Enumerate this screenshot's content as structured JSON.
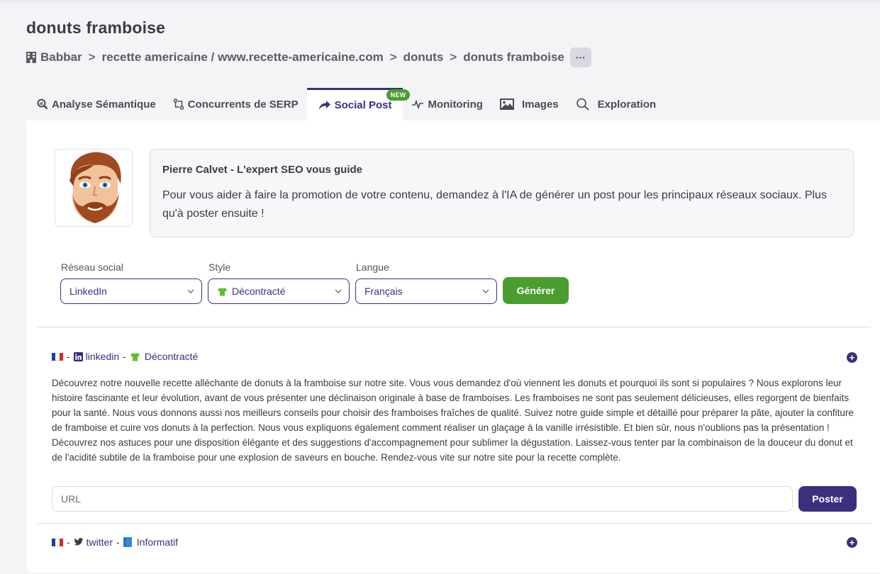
{
  "page": {
    "title": "donuts framboise"
  },
  "breadcrumb": {
    "items": [
      "Babbar",
      "recette americaine / www.recette-americaine.com",
      "donuts",
      "donuts framboise"
    ],
    "separator": ">",
    "more_label": "···"
  },
  "tabs": [
    {
      "label": "Analyse Sémantique",
      "icon": "analysis-icon"
    },
    {
      "label": "Concurrents de SERP",
      "icon": "compare-icon"
    },
    {
      "label": "Social Post",
      "icon": "share-icon",
      "active": true,
      "badge": "NEW"
    },
    {
      "label": "Monitoring",
      "icon": "pulse-icon"
    },
    {
      "label": "Images",
      "icon": "image-icon"
    },
    {
      "label": "Exploration",
      "icon": "search-icon"
    }
  ],
  "expert": {
    "title": "Pierre Calvet - L'expert SEO vous guide",
    "text": "Pour vous aider à faire la promotion de votre contenu, demandez à l'IA de générer un post pour les principaux réseaux sociaux. Plus qu'à poster ensuite !"
  },
  "form": {
    "network": {
      "label": "Réseau social",
      "value": "LinkedIn"
    },
    "style": {
      "label": "Style",
      "value": "Décontracté"
    },
    "language": {
      "label": "Langue",
      "value": "Français"
    },
    "generate_label": "Générer"
  },
  "posts": [
    {
      "network": "linkedin",
      "style": "Décontracté",
      "text": "Découvrez notre nouvelle recette alléchante de donuts à la framboise sur notre site. Vous vous demandez d'où viennent les donuts et pourquoi ils sont si populaires ? Nous explorons leur histoire fascinante et leur évolution, avant de vous présenter une déclinaison originale à base de framboises. Les framboises ne sont pas seulement délicieuses, elles regorgent de bienfaits pour la santé. Nous vous donnons aussi nos meilleurs conseils pour choisir des framboises fraîches de qualité. Suivez notre guide simple et détaillé pour préparer la pâte, ajouter la confiture de framboise et cuire vos donuts à la perfection. Nous vous expliquons également comment réaliser un glaçage à la vanille irrésistible. Et bien sûr, nous n'oublions pas la présentation ! Découvrez nos astuces pour une disposition élégante et des suggestions d'accompagnement pour sublimer la dégustation. Laissez-vous tenter par la combinaison de la douceur du donut et de l'acidité subtile de la framboise pour une explosion de saveurs en bouche. Rendez-vous vite sur notre site pour la recette complète.",
      "url_placeholder": "URL",
      "post_label": "Poster"
    },
    {
      "network": "twitter",
      "style": "Informatif"
    }
  ],
  "colors": {
    "primary": "#3b2f7e",
    "success": "#4a9d2e",
    "badge": "#4a9d2e"
  }
}
